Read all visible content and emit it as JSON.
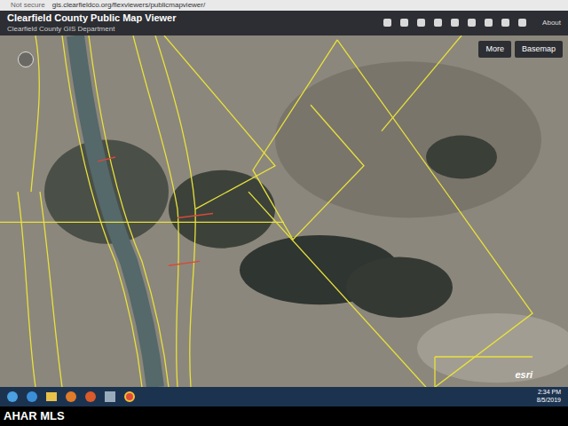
{
  "browser": {
    "security": "Not secure",
    "url": "gis.clearfieldco.org/flexviewers/publicmapviewer/"
  },
  "header": {
    "title": "Clearfield County Public Map Viewer",
    "subtitle": "Clearfield County GIS Department",
    "about": "About"
  },
  "map_buttons": [
    "More",
    "Basemap"
  ],
  "attribution": "esri",
  "taskbar": {
    "time": "2:34 PM",
    "date": "8/5/2019"
  },
  "watermark": "AHAR MLS"
}
